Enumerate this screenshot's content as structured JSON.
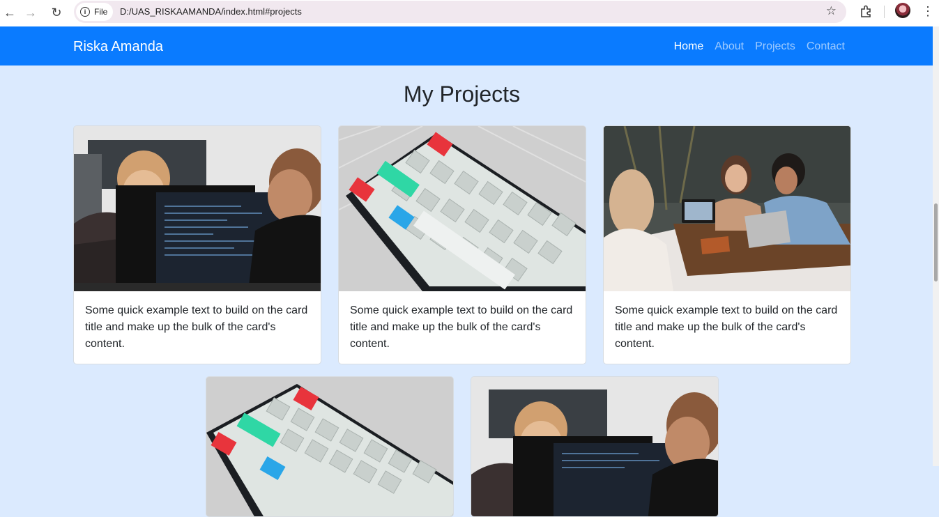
{
  "browser": {
    "file_label": "File",
    "url": "D:/UAS_RISKAAMANDA/index.html#projects"
  },
  "navbar": {
    "brand": "Riska Amanda",
    "links": [
      "Home",
      "About",
      "Projects",
      "Contact"
    ],
    "active": "Home"
  },
  "section": {
    "title": "My Projects"
  },
  "cards": [
    {
      "image": "people-coding-photo",
      "text": "Some quick example text to build on the card title and make up the bulk of the card's content."
    },
    {
      "image": "keyboard-photo",
      "text": "Some quick example text to build on the card title and make up the bulk of the card's content."
    },
    {
      "image": "team-meeting-photo",
      "text": "Some quick example text to build on the card title and make up the bulk of the card's content."
    },
    {
      "image": "keyboard-photo",
      "text": ""
    },
    {
      "image": "people-coding-photo",
      "text": ""
    }
  ],
  "colors": {
    "navbar": "#0a7bff",
    "page_bg": "#dbeafe"
  }
}
